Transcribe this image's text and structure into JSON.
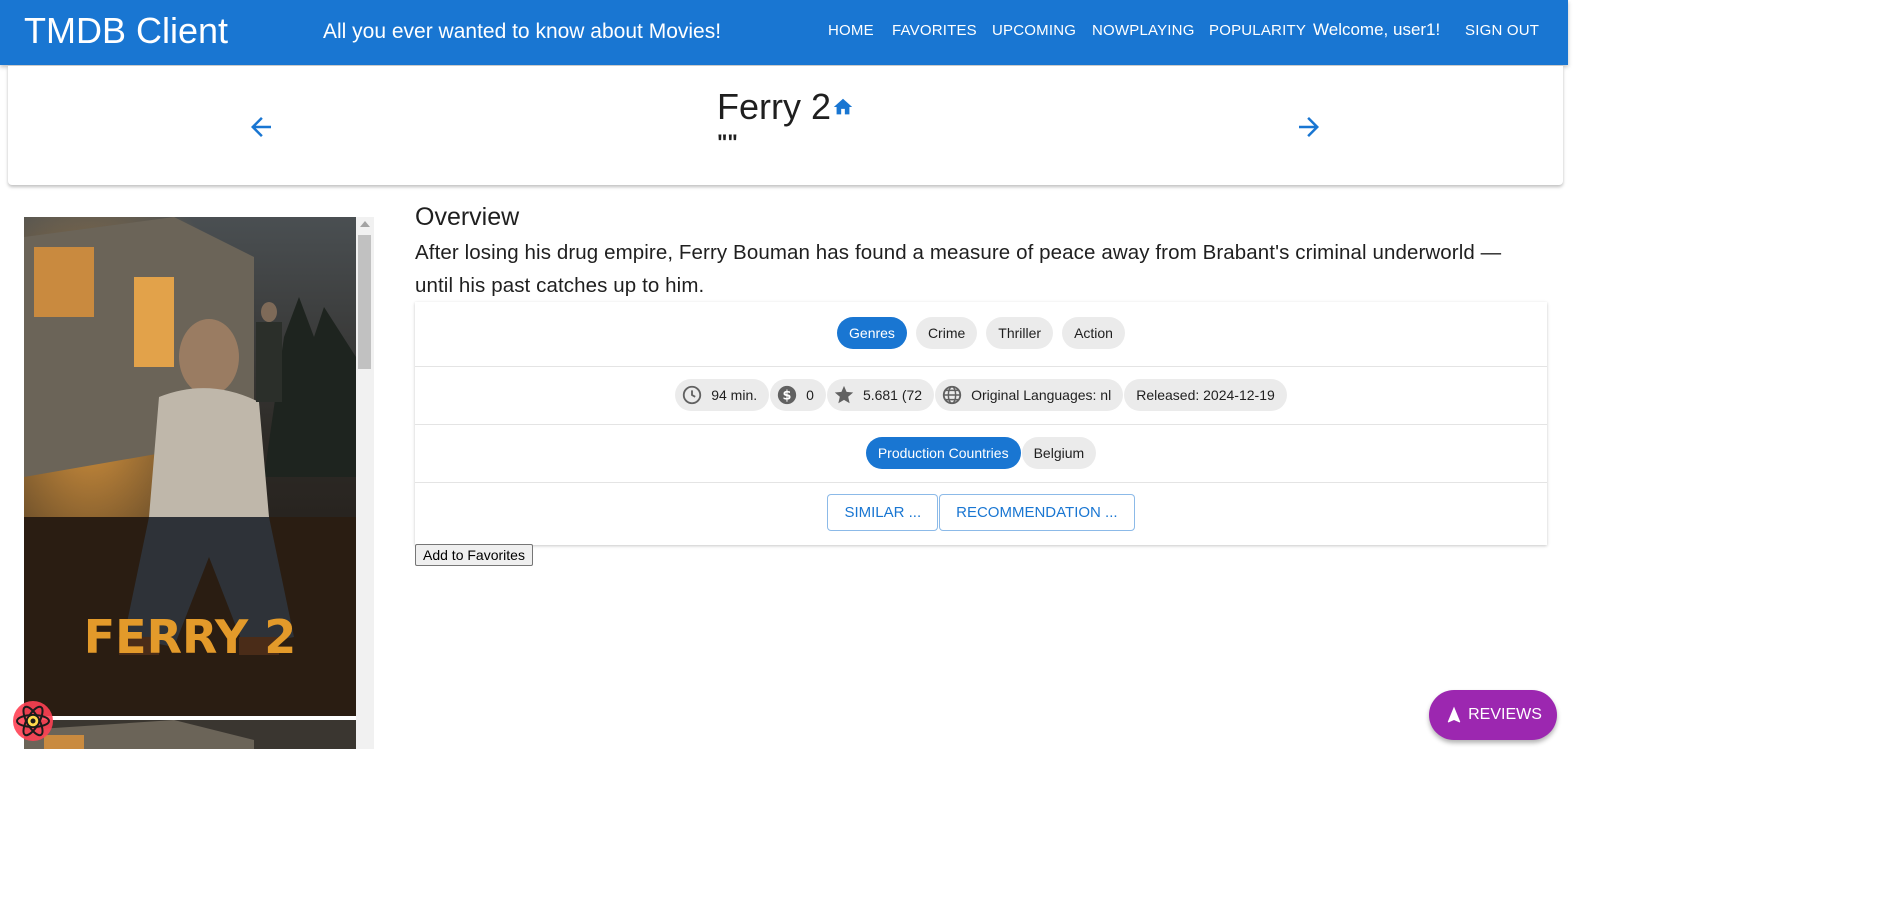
{
  "header": {
    "app_title": "TMDB Client",
    "tagline": "All you ever wanted to know about Movies!",
    "nav": [
      "HOME",
      "FAVORITES",
      "UPCOMING",
      "NOWPLAYING",
      "POPULARITY"
    ],
    "welcome": "Welcome, user1!",
    "sign_out": "SIGN OUT",
    "bg_color": "#1976d2"
  },
  "movie": {
    "title": "Ferry 2",
    "tagline": "\"\"",
    "poster_text": "FERRY 2",
    "overview_heading": "Overview",
    "overview": "After losing his drug empire, Ferry Bouman has found a measure of peace away from Brabant's criminal underworld — until his past catches up to him.",
    "genres_label": "Genres",
    "genres": [
      "Crime",
      "Thriller",
      "Action"
    ],
    "runtime": "94 min.",
    "revenue": "0",
    "rating": "5.681 (72",
    "languages": "Original Languages: nl",
    "released": "Released: 2024-12-19",
    "countries_label": "Production Countries",
    "countries": [
      "Belgium"
    ],
    "similar_label": "SIMILAR ...",
    "recommendation_label": "RECOMMENDATION ...",
    "add_favorites": "Add to Favorites",
    "reviews_label": "REVIEWS"
  },
  "colors": {
    "primary": "#1976d2",
    "fab": "#9c27b0",
    "chip": "#ebebeb"
  }
}
